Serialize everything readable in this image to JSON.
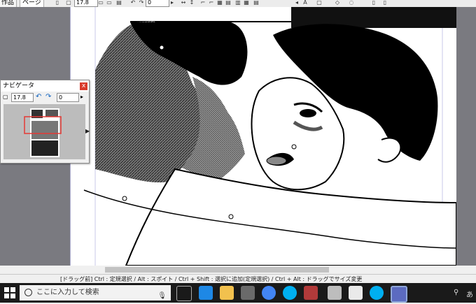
{
  "toolbar": {
    "tabs": [
      "作品",
      "ページ"
    ],
    "zoom_value": "17.8",
    "rotate_value": "0"
  },
  "navigator": {
    "title": "ナビゲータ",
    "close_label": "x",
    "zoom_value": "17.8",
    "rotate_value": "0"
  },
  "status_bar": {
    "text": "[ドラッグ前] Ctrl : 定規選択 / Alt : スポイト / Ctrl + Shift : 選択に追加(定規選択) / Ctrl + Alt : ドラッグでサイズ変更"
  },
  "taskbar": {
    "search_placeholder": "ここに入力して検索",
    "tray_label": "あ"
  },
  "colors": {
    "accent_red": "#d93a2b",
    "taskbar": "#1a1a1a"
  }
}
